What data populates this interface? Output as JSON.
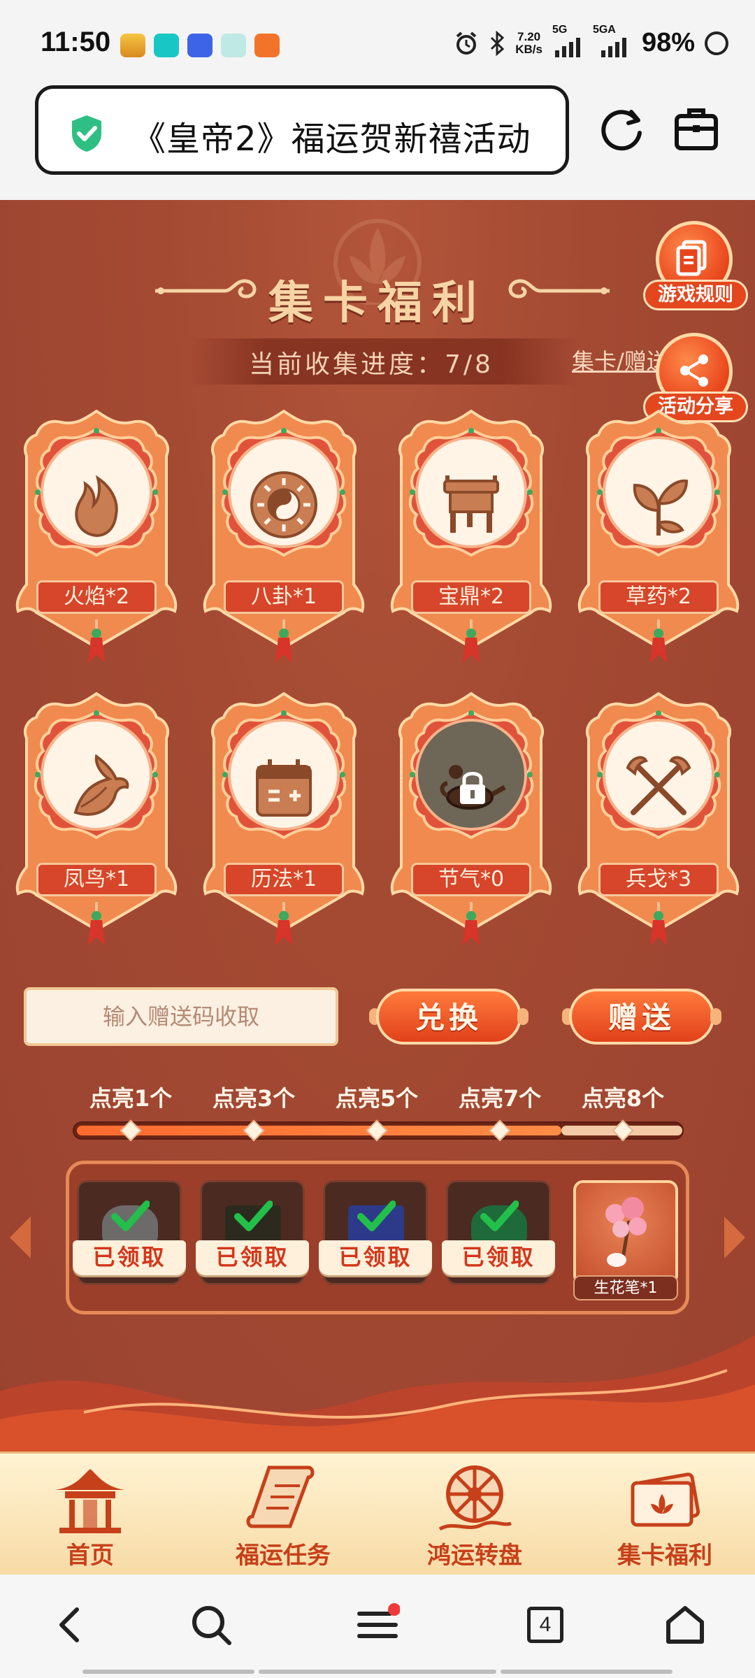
{
  "status_bar": {
    "time": "11:50",
    "net_speed_value": "7.20",
    "net_speed_unit": "KB/s",
    "signal1": "5G",
    "signal2": "5GA",
    "battery": "98%",
    "app_icons": [
      "app-icon-1",
      "tap-icon",
      "vivo-icon",
      "app-icon-4",
      "app-icon-5"
    ]
  },
  "url_bar": {
    "title": "《皇帝2》福运贺新禧活动",
    "secure_color": "#2fbf84"
  },
  "game": {
    "title": "集卡福利",
    "progress_label": "当前收集进度：",
    "progress_value": "7/8",
    "collect_link": "集卡/赠送",
    "side_buttons": [
      {
        "label": "游戏规则",
        "icon": "document-icon"
      },
      {
        "label": "活动分享",
        "icon": "share-icon"
      }
    ],
    "cards": [
      {
        "label": "火焰*2",
        "icon": "flame-icon",
        "locked": false
      },
      {
        "label": "八卦*1",
        "icon": "bagua-icon",
        "locked": false
      },
      {
        "label": "宝鼎*2",
        "icon": "cauldron-icon",
        "locked": false
      },
      {
        "label": "草药*2",
        "icon": "herb-icon",
        "locked": false
      },
      {
        "label": "凤鸟*1",
        "icon": "phoenix-icon",
        "locked": false
      },
      {
        "label": "历法*1",
        "icon": "calendar-icon",
        "locked": false
      },
      {
        "label": "节气*0",
        "icon": "teapot-icon",
        "locked": true
      },
      {
        "label": "兵戈*3",
        "icon": "crossed-weapons-icon",
        "locked": false
      }
    ],
    "code_input_placeholder": "输入赠送码收取",
    "exchange_label": "兑换",
    "gift_label": "赠送",
    "milestones": [
      "点亮1个",
      "点亮3个",
      "点亮5个",
      "点亮7个",
      "点亮8个"
    ],
    "progress_fraction": 0.8,
    "rewards": [
      {
        "status": "已领取",
        "icon": "stone-reward-icon"
      },
      {
        "status": "已领取",
        "icon": "book-reward-icon"
      },
      {
        "status": "已领取",
        "icon": "scroll-reward-icon"
      },
      {
        "status": "已领取",
        "icon": "jade-reward-icon"
      },
      {
        "status": "生花笔*1",
        "icon": "blossom-brush-icon"
      }
    ]
  },
  "tabs": [
    {
      "label": "首页",
      "icon": "pavilion-icon"
    },
    {
      "label": "福运任务",
      "icon": "scroll-icon"
    },
    {
      "label": "鸿运转盘",
      "icon": "wheel-icon"
    },
    {
      "label": "集卡福利",
      "icon": "cards-icon"
    }
  ],
  "browser_nav": {
    "tab_count": "4",
    "menu_has_dot": true
  },
  "colors": {
    "background": "#a44a33",
    "accent": "#e1411a",
    "title": "#f6d4a6",
    "tab_label": "#c6401a"
  }
}
